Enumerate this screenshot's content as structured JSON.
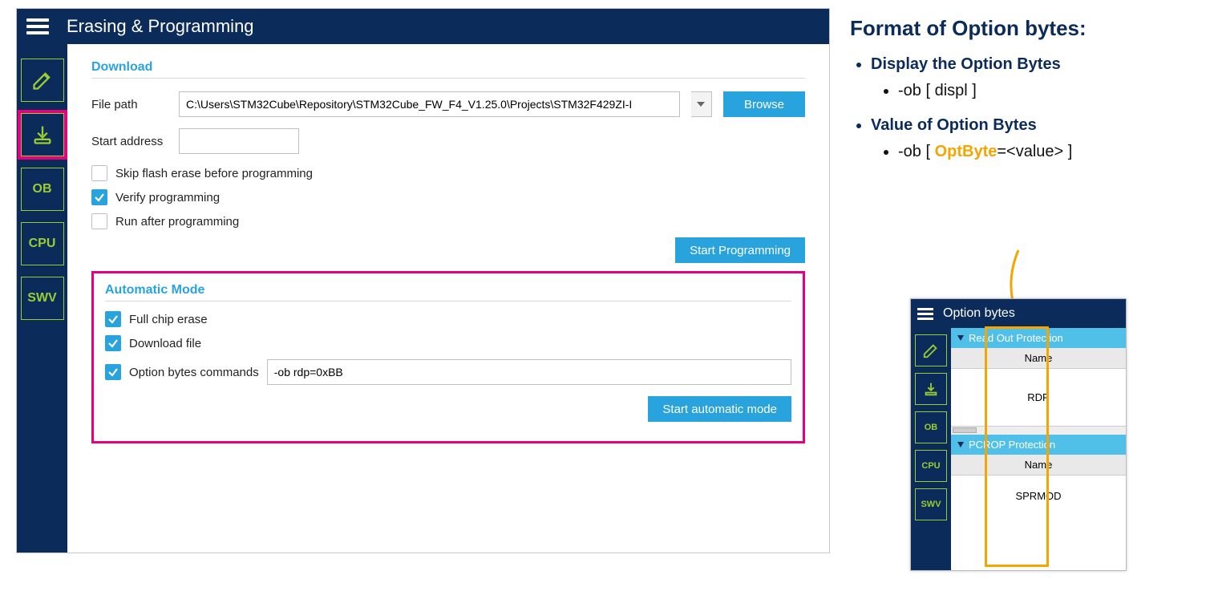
{
  "colors": {
    "navy": "#0b2b5a",
    "accent": "#29a3dd",
    "lime": "#9acd32",
    "magenta": "#e4007f",
    "gold": "#f5a500"
  },
  "header": {
    "title": "Erasing & Programming"
  },
  "sidebar": {
    "items": [
      {
        "name": "edit-icon"
      },
      {
        "name": "download-icon"
      },
      {
        "name": "ob-icon",
        "label": "OB"
      },
      {
        "name": "cpu-icon",
        "label": "CPU"
      },
      {
        "name": "swv-icon",
        "label": "SWV"
      }
    ],
    "selected_index": 1
  },
  "download": {
    "section_title": "Download",
    "file_path_label": "File path",
    "file_path_value": "C:\\Users\\STM32Cube\\Repository\\STM32Cube_FW_F4_V1.25.0\\Projects\\STM32F429ZI-I",
    "browse_label": "Browse",
    "start_address_label": "Start address",
    "start_address_value": "",
    "opts": {
      "skip_erase": {
        "label": "Skip flash erase before programming",
        "checked": false
      },
      "verify": {
        "label": "Verify programming",
        "checked": true
      },
      "run_after": {
        "label": "Run after programming",
        "checked": false
      }
    },
    "start_btn": "Start Programming"
  },
  "automatic": {
    "section_title": "Automatic Mode",
    "full_erase": {
      "label": "Full chip erase",
      "checked": true
    },
    "dl_file": {
      "label": "Download file",
      "checked": true
    },
    "ob_cmds": {
      "label": "Option bytes commands",
      "checked": true
    },
    "ob_cmd_value": "-ob rdp=0xBB",
    "start_btn": "Start automatic mode"
  },
  "notes": {
    "heading": "Format of Option bytes:",
    "b1": "Display the Option Bytes",
    "b1_sub": "-ob [ displ ]",
    "b2": "Value of Option Bytes",
    "b2_sub_prefix": "-ob [ ",
    "b2_sub_opt": "OptByte",
    "b2_sub_suffix": "=<value> ]"
  },
  "mini": {
    "title": "Option bytes",
    "sec1_head": "Read Out Protection",
    "col_head": "Name",
    "row1": "RDP",
    "sec2_head": "PCROP Protection",
    "row2": "SPRMOD"
  }
}
